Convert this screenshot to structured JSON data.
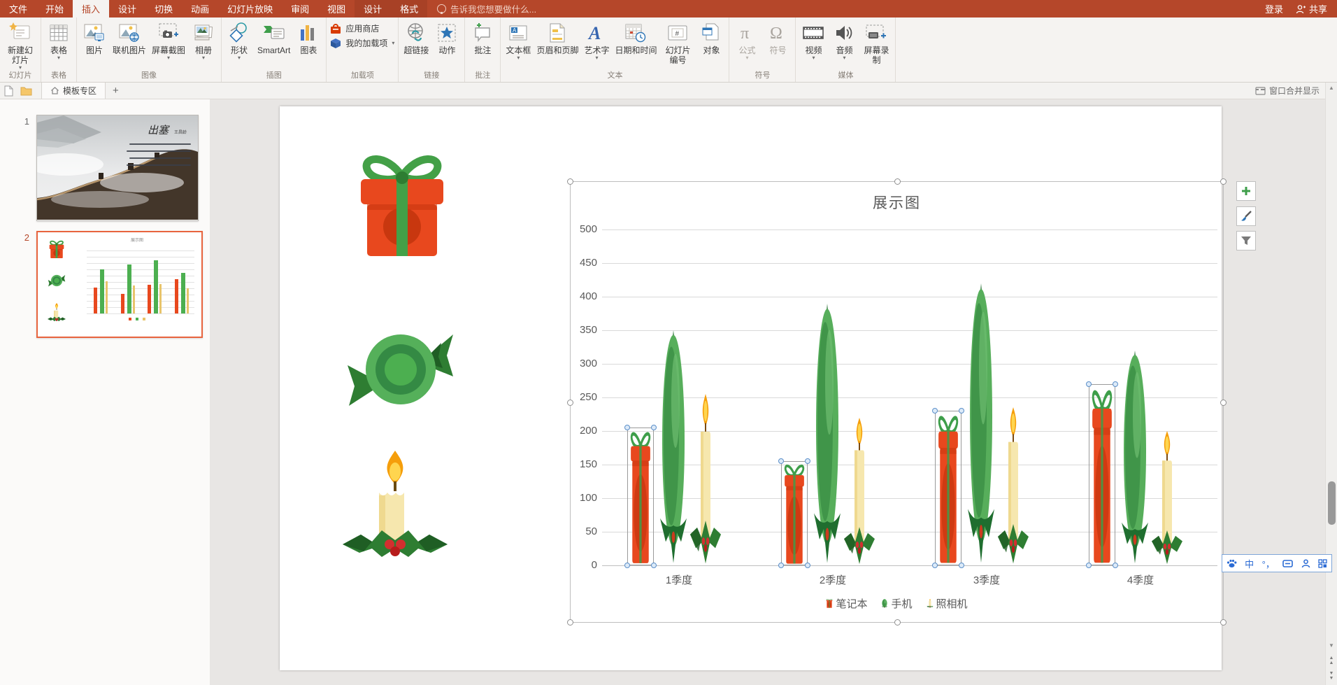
{
  "titlebar": {
    "tabs": [
      "文件",
      "开始",
      "插入",
      "设计",
      "切换",
      "动画",
      "幻灯片放映",
      "审阅",
      "视图",
      "设计",
      "格式"
    ],
    "active_tab": "插入",
    "tellme": "告诉我您想要做什么...",
    "signin": "登录",
    "share": "共享"
  },
  "ribbon": {
    "groups": [
      {
        "label": "幻灯片",
        "buttons": [
          "新建幻灯片"
        ]
      },
      {
        "label": "表格",
        "buttons": [
          "表格"
        ]
      },
      {
        "label": "图像",
        "buttons": [
          "图片",
          "联机图片",
          "屏幕截图",
          "相册"
        ]
      },
      {
        "label": "插图",
        "buttons": [
          "形状",
          "SmartArt",
          "图表"
        ]
      },
      {
        "label": "加载项",
        "buttons": [
          "应用商店",
          "我的加载项"
        ]
      },
      {
        "label": "链接",
        "buttons": [
          "超链接",
          "动作"
        ]
      },
      {
        "label": "批注",
        "buttons": [
          "批注"
        ]
      },
      {
        "label": "文本",
        "buttons": [
          "文本框",
          "页眉和页脚",
          "艺术字",
          "日期和时间",
          "幻灯片编号",
          "对象"
        ]
      },
      {
        "label": "符号",
        "buttons": [
          "公式",
          "符号"
        ]
      },
      {
        "label": "媒体",
        "buttons": [
          "视频",
          "音频",
          "屏幕录制"
        ]
      }
    ],
    "b": {
      "new_slide": "新建幻灯片",
      "table": "表格",
      "picture": "图片",
      "online_picture": "联机图片",
      "screenshot": "屏幕截图",
      "album": "相册",
      "shapes": "形状",
      "smartart": "SmartArt",
      "chart": "图表",
      "store": "应用商店",
      "my_addins": "我的加载项",
      "hyperlink": "超链接",
      "action": "动作",
      "comment": "批注",
      "textbox": "文本框",
      "header_footer": "页眉和页脚",
      "wordart": "艺术字",
      "datetime": "日期和时间",
      "slide_number": "幻灯片编号",
      "object": "对象",
      "equation": "公式",
      "symbol": "符号",
      "video": "视频",
      "audio": "音频",
      "screen_record": "屏幕录制"
    },
    "gl": {
      "slides": "幻灯片",
      "table": "表格",
      "image": "图像",
      "illustration": "插图",
      "addins": "加载项",
      "links": "链接",
      "comments": "批注",
      "text": "文本",
      "symbols": "符号",
      "media": "媒体"
    }
  },
  "plugin_bar": {
    "tab_label": "模板专区",
    "window_merge_label": "窗口合并显示"
  },
  "slides_panel": {
    "slides": [
      {
        "number": "1",
        "calligraphy_title": "出塞",
        "selected": false
      },
      {
        "number": "2",
        "selected": true
      }
    ]
  },
  "chart_data": {
    "type": "bar",
    "title": "展示图",
    "categories": [
      "1季度",
      "2季度",
      "3季度",
      "4季度"
    ],
    "series": [
      {
        "name": "笔记本",
        "marker": "gift-red",
        "color": "#E8481E",
        "values": [
          205,
          155,
          230,
          270
        ],
        "selected": true
      },
      {
        "name": "手机",
        "marker": "candy-green",
        "color": "#4CAF50",
        "values": [
          350,
          390,
          420,
          320
        ],
        "selected": false
      },
      {
        "name": "照相机",
        "marker": "candle-yellow",
        "color": "#E8C46B",
        "values": [
          255,
          220,
          235,
          200
        ],
        "selected": false
      }
    ],
    "ylim": [
      0,
      500
    ],
    "ytick_step": 50,
    "yticks": [
      "500",
      "450",
      "400",
      "350",
      "300",
      "250",
      "200",
      "150",
      "100",
      "50",
      "0"
    ],
    "legend_position": "bottom",
    "gridlines": true
  },
  "chart_tools": {
    "buttons": [
      "chart-elements",
      "chart-styles",
      "chart-filters"
    ]
  },
  "ime_bar": {
    "icons": [
      "paw-icon",
      "chinese-mode-icon",
      "punctuation-icon",
      "board-icon",
      "person-icon",
      "grid-icon"
    ],
    "chinese_mode": "中",
    "punctuation": "°，"
  }
}
